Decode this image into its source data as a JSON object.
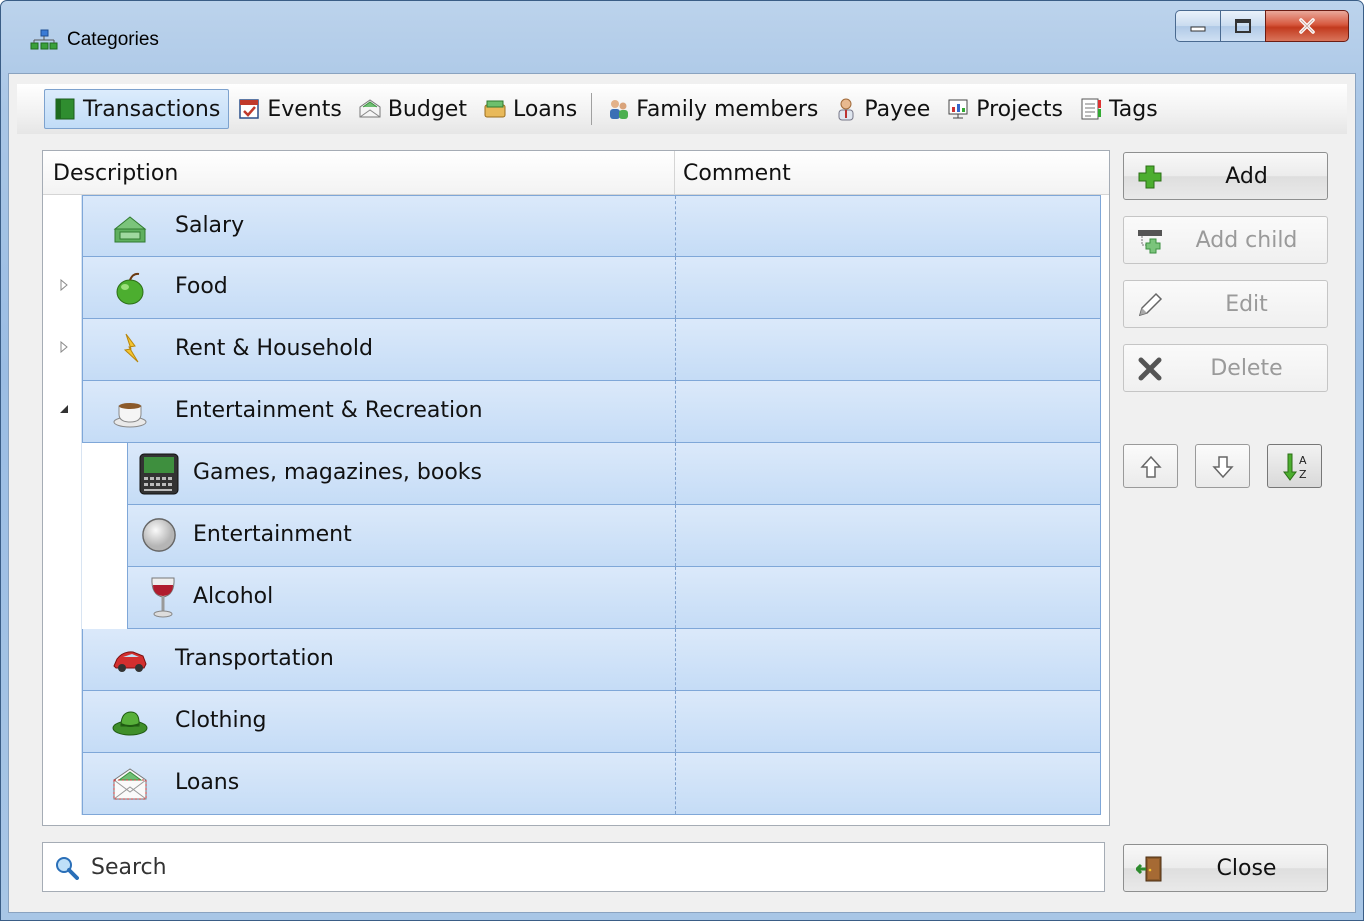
{
  "window": {
    "title": "Categories"
  },
  "tabs": [
    {
      "label": "Transactions",
      "icon": "book-icon",
      "active": true
    },
    {
      "label": "Events",
      "icon": "calendar-icon",
      "active": false
    },
    {
      "label": "Budget",
      "icon": "envelope-icon",
      "active": false
    },
    {
      "label": "Loans",
      "icon": "money-icon",
      "active": false
    },
    {
      "label": "Family members",
      "icon": "people-icon",
      "active": false
    },
    {
      "label": "Payee",
      "icon": "person-icon",
      "active": false
    },
    {
      "label": "Projects",
      "icon": "chart-icon",
      "active": false
    },
    {
      "label": "Tags",
      "icon": "tag-list-icon",
      "active": false
    }
  ],
  "tree": {
    "columns": {
      "description": "Description",
      "comment": "Comment"
    },
    "rows": [
      {
        "label": "Salary",
        "icon": "money-stack-icon",
        "level": 0,
        "expander": "none"
      },
      {
        "label": "Food",
        "icon": "apple-icon",
        "level": 0,
        "expander": "collapsed"
      },
      {
        "label": "Rent & Household",
        "icon": "lightning-icon",
        "level": 0,
        "expander": "collapsed"
      },
      {
        "label": "Entertainment & Recreation",
        "icon": "coffee-cup-icon",
        "level": 0,
        "expander": "expanded"
      },
      {
        "label": "Games, magazines, books",
        "icon": "handheld-device-icon",
        "level": 1,
        "expander": "none"
      },
      {
        "label": "Entertainment",
        "icon": "gray-circle-icon",
        "level": 1,
        "expander": "none"
      },
      {
        "label": "Alcohol",
        "icon": "wine-glass-icon",
        "level": 1,
        "expander": "none"
      },
      {
        "label": "Transportation",
        "icon": "car-icon",
        "level": 0,
        "expander": "none"
      },
      {
        "label": "Clothing",
        "icon": "hat-icon",
        "level": 0,
        "expander": "none"
      },
      {
        "label": "Loans",
        "icon": "envelope-money-icon",
        "level": 0,
        "expander": "none"
      }
    ]
  },
  "buttons": {
    "add": "Add",
    "add_child": "Add child",
    "edit": "Edit",
    "delete": "Delete",
    "close": "Close"
  },
  "search": {
    "placeholder": "Search"
  }
}
